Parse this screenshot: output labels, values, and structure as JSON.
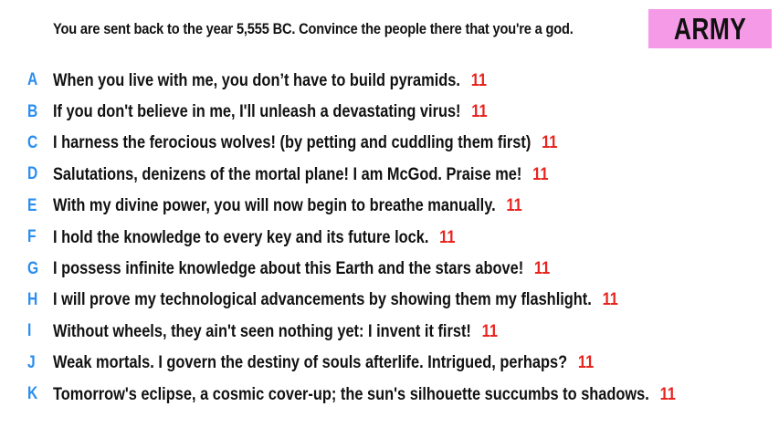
{
  "prompt": "You are sent back to the year 5,555 BC. Convince the people there that you're a god.",
  "team": {
    "label": "ARMY",
    "color": "#f59ae6"
  },
  "colors": {
    "letter": "#2a8df0",
    "score": "#e8231e"
  },
  "answers": [
    {
      "letter": "A",
      "text": "When you live with me, you don’t have to build pyramids.",
      "score": "11"
    },
    {
      "letter": "B",
      "text": "If you don't believe in me, I'll unleash a devastating virus!",
      "score": "11"
    },
    {
      "letter": "C",
      "text": "I harness the ferocious wolves! (by petting and cuddling them first)",
      "score": "11"
    },
    {
      "letter": "D",
      "text": "Salutations, denizens of the mortal plane! I am McGod. Praise me!",
      "score": "11"
    },
    {
      "letter": "E",
      "text": "With my divine power, you will now begin to breathe manually.",
      "score": "11"
    },
    {
      "letter": "F",
      "text": "I hold the knowledge to every key and its future lock.",
      "score": "11"
    },
    {
      "letter": "G",
      "text": "I possess infinite knowledge about this Earth and the stars above!",
      "score": "11"
    },
    {
      "letter": "H",
      "text": "I will prove my technological advancements by showing them my flashlight.",
      "score": "11"
    },
    {
      "letter": "I",
      "text": "Without wheels, they ain't seen nothing yet: I invent it first!",
      "score": "11"
    },
    {
      "letter": "J",
      "text": "Weak mortals. I govern the destiny of souls afterlife. Intrigued, perhaps?",
      "score": "11"
    },
    {
      "letter": "K",
      "text": "Tomorrow's eclipse, a cosmic cover-up; the sun's silhouette succumbs to shadows.",
      "score": "11"
    }
  ]
}
